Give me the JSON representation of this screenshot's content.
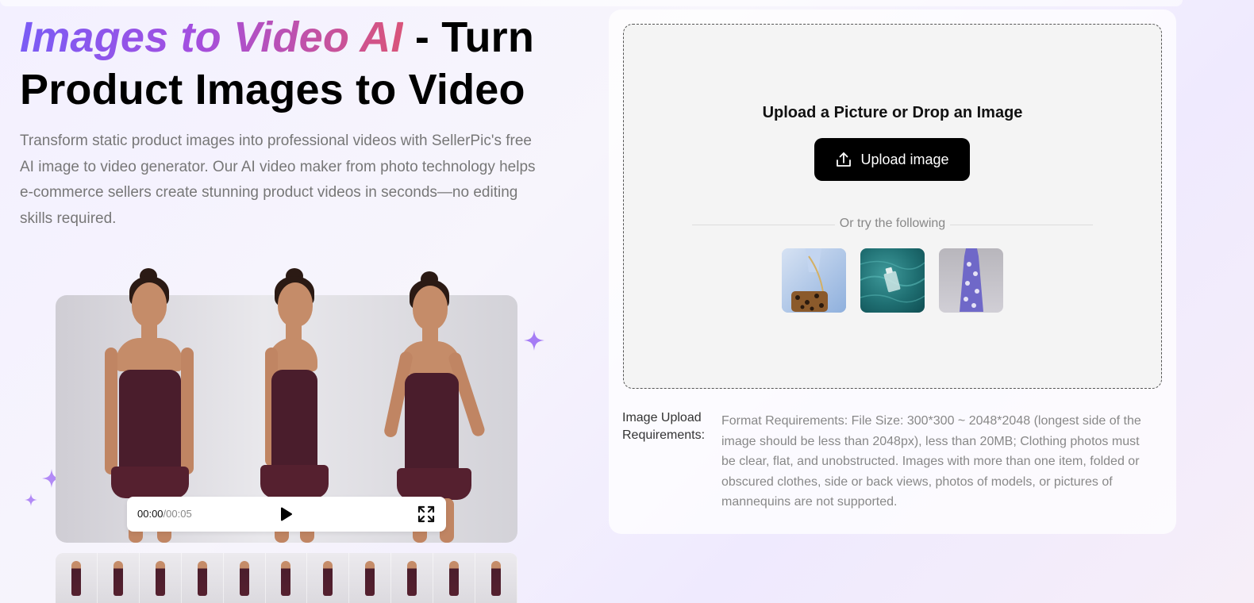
{
  "hero": {
    "title_highlight": "Images to Video AI",
    "title_rest": " - Turn Product Images to Video",
    "description": "Transform static product images into professional videos with SellerPic's free AI image to video generator. Our AI video maker from photo technology helps e-commerce sellers create stunning product videos in seconds—no editing skills required."
  },
  "video": {
    "current_time": "00:00",
    "duration": "/00:05",
    "play_icon": "play-icon",
    "fullscreen_icon": "fullscreen-icon"
  },
  "upload": {
    "title": "Upload a Picture or Drop an Image",
    "button_label": "Upload image",
    "button_icon": "upload-icon",
    "or_text": "Or try the following",
    "samples": [
      "sample-shirt-bag",
      "sample-perfume-water",
      "sample-floral-dress"
    ]
  },
  "requirements": {
    "label": "Image Upload Requirements:",
    "text": "Format Requirements: File Size: 300*300 ~ 2048*2048 (longest side of the image should be less than 2048px), less than 20MB; Clothing photos must be clear, flat, and unobstructed. Images with more than one item, folded or obscured clothes, side or back views, photos of models, or pictures of mannequins are not supported."
  },
  "colors": {
    "gradient_start": "#7a5cf5",
    "gradient_mid": "#a34fe0",
    "gradient_end": "#d9547a",
    "button_bg": "#000000",
    "sparkle": "#a57cf5"
  }
}
